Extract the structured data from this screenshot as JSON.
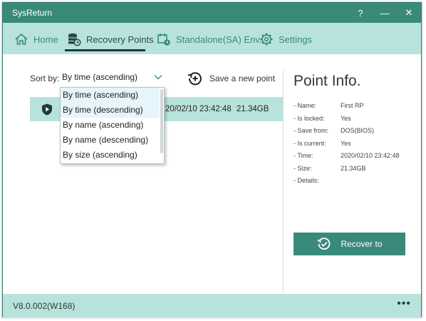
{
  "app": {
    "title": "SysReturn"
  },
  "titlebar": {
    "help": "?",
    "minimize": "—",
    "close": "✕"
  },
  "nav": {
    "items": [
      {
        "label": "Home",
        "icon": "home-icon"
      },
      {
        "label": "Recovery Points",
        "icon": "database-clock-icon",
        "active": true
      },
      {
        "label": "Standalone(SA) Env.",
        "icon": "calendar-clock-icon"
      },
      {
        "label": "Settings",
        "icon": "gear-icon"
      }
    ]
  },
  "sort": {
    "label": "Sort by:",
    "selected": "By time (ascending)",
    "options": [
      "By time (ascending)",
      "By time (descending)",
      "By name (ascending)",
      "By name (descending)",
      "By size (ascending)"
    ],
    "hovered_option": "By time (descending)"
  },
  "actions": {
    "save_point": "Save a new point"
  },
  "points": [
    {
      "time": "20/02/10 23:42:48",
      "size": "21.34GB"
    }
  ],
  "info": {
    "title": "Point Info.",
    "rows": [
      {
        "key": "- Name:",
        "value": "First RP"
      },
      {
        "key": "- Is locked:",
        "value": "Yes"
      },
      {
        "key": "- Save from:",
        "value": "DOS(BIOS)"
      },
      {
        "key": "- Is current:",
        "value": "Yes"
      },
      {
        "key": "- Time:",
        "value": "2020/02/10 23:42:48"
      },
      {
        "key": "- Size:",
        "value": "21.34GB"
      },
      {
        "key": "- Details:",
        "value": ""
      }
    ],
    "recover_button": "Recover to"
  },
  "footer": {
    "version": "V8.0.002(W168)",
    "more": "•••"
  },
  "colors": {
    "accent": "#3a8a7c",
    "light_accent": "#b8e3dc",
    "hover": "#e6f4fb"
  }
}
